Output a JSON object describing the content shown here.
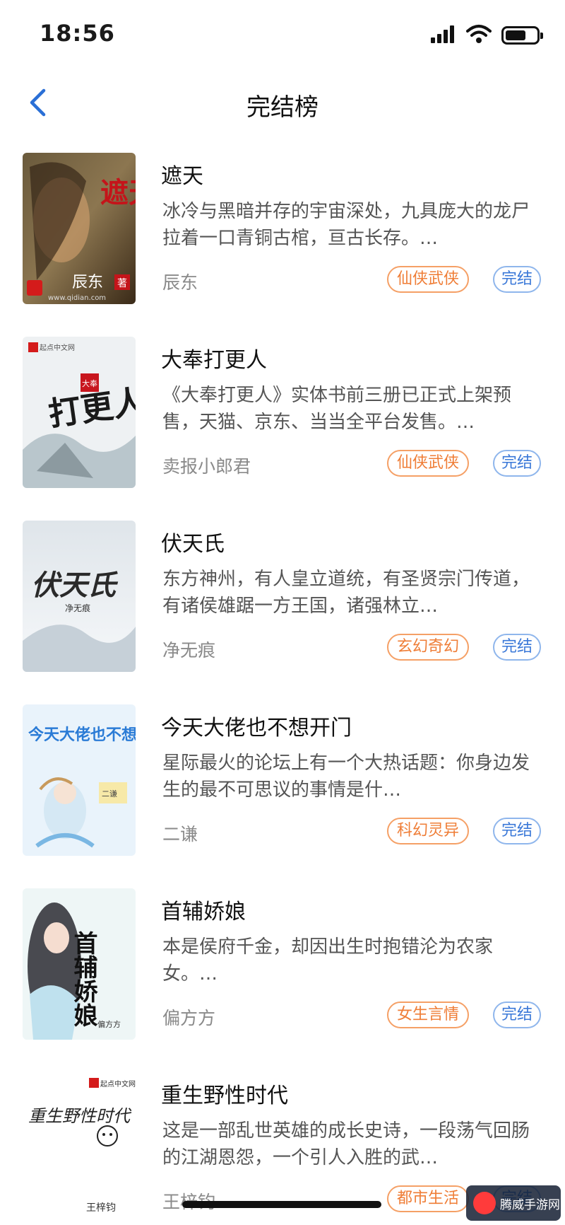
{
  "status_bar": {
    "time": "18:56"
  },
  "nav": {
    "title": "完结榜"
  },
  "books": [
    {
      "title": "遮天",
      "desc": "冰冷与黑暗并存的宇宙深处，九具庞大的龙尸拉着一口青铜古棺，亘古长存。…",
      "author": "辰东",
      "genre": "仙侠武侠",
      "status": "完结"
    },
    {
      "title": "大奉打更人",
      "desc": "《大奉打更人》实体书前三册已正式上架预售，天猫、京东、当当全平台发售。…",
      "author": "卖报小郎君",
      "genre": "仙侠武侠",
      "status": "完结"
    },
    {
      "title": "伏天氏",
      "desc": "东方神州，有人皇立道统，有圣贤宗门传道，有诸侯雄踞一方王国，诸强林立…",
      "author": "净无痕",
      "genre": "玄幻奇幻",
      "status": "完结"
    },
    {
      "title": "今天大佬也不想开门",
      "desc": "星际最火的论坛上有一个大热话题：你身边发生的最不可思议的事情是什…",
      "author": "二谦",
      "genre": "科幻灵异",
      "status": "完结"
    },
    {
      "title": "首辅娇娘",
      "desc": "本是侯府千金，却因出生时抱错沦为农家女。…",
      "author": "偏方方",
      "genre": "女生言情",
      "status": "完结"
    },
    {
      "title": "重生野性时代",
      "desc": "这是一部乱世英雄的成长史诗，一段荡气回肠的江湖恩怨，一个引人入胜的武…",
      "author": "王梓钧",
      "genre": "都市生活",
      "status": "完结"
    }
  ],
  "covers": [
    {
      "title_text": "遮天",
      "author_text": "辰东",
      "badge": "著",
      "site": "www.qidian.com"
    },
    {
      "title_text": "打更人",
      "badge": "大奉",
      "publisher": "起点中文网"
    },
    {
      "title_text": "伏天氏",
      "author_text": "净无痕"
    },
    {
      "title_text": "今天大佬也不想开门",
      "author_text": "二谦"
    },
    {
      "title_text": "首辅娇娘",
      "author_text": "偏方方"
    },
    {
      "title_text": "重生野性时代",
      "author_text": "王梓钧",
      "publisher": "起点中文网"
    }
  ],
  "watermark": {
    "text": "腾威手游网"
  }
}
